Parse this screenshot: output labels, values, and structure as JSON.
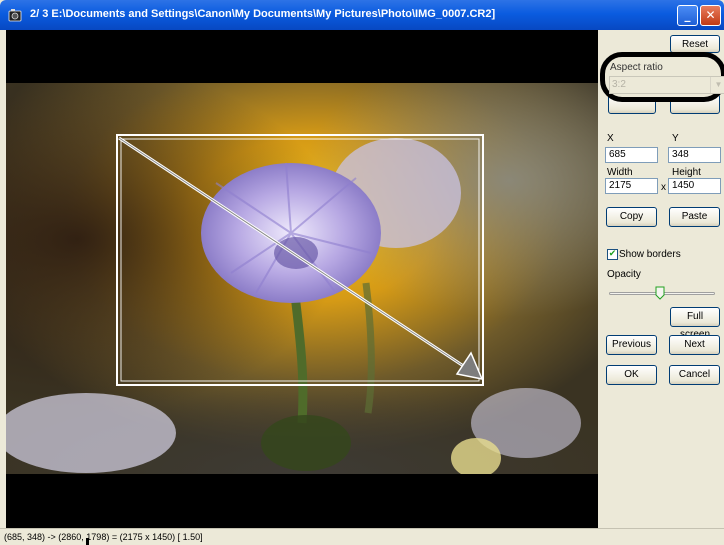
{
  "window": {
    "title": "2/ 3  E:\\Documents and Settings\\Canon\\My Documents\\My Pictures\\Photo\\IMG_0007.CR2]",
    "controls": {
      "minimize": "_",
      "maximize": "□",
      "close": "✕"
    }
  },
  "panel": {
    "reset_label": "Reset",
    "aspect_ratio": {
      "label": "Aspect ratio",
      "value": "3:2"
    },
    "x": {
      "label": "X",
      "value": "685"
    },
    "y": {
      "label": "Y",
      "value": "348"
    },
    "width": {
      "label": "Width",
      "value": "2175"
    },
    "height": {
      "label": "Height",
      "value": "1450"
    },
    "dimension_separator": "x",
    "copy_label": "Copy",
    "paste_label": "Paste",
    "show_borders": {
      "label": "Show borders",
      "checked": true
    },
    "opacity": {
      "label": "Opacity",
      "level": 0.48
    },
    "full_screen_label": "Full screen",
    "previous_label": "Previous",
    "next_label": "Next",
    "ok_label": "OK",
    "cancel_label": "Cancel"
  },
  "status": {
    "text": "(685,  348) -> (2860, 1798) = (2175 x 1450) [ 1.50]"
  },
  "icons": {
    "app": "app-icon",
    "check": "✔",
    "dropdown": "▼",
    "slider_thumb": "slider-thumb-icon",
    "crop_arrow": "diagonal-arrow-icon"
  },
  "colors": {
    "titlebar": "#0b5ce0",
    "crop_border": "#ffffff",
    "highlight_ring": "#000000"
  }
}
